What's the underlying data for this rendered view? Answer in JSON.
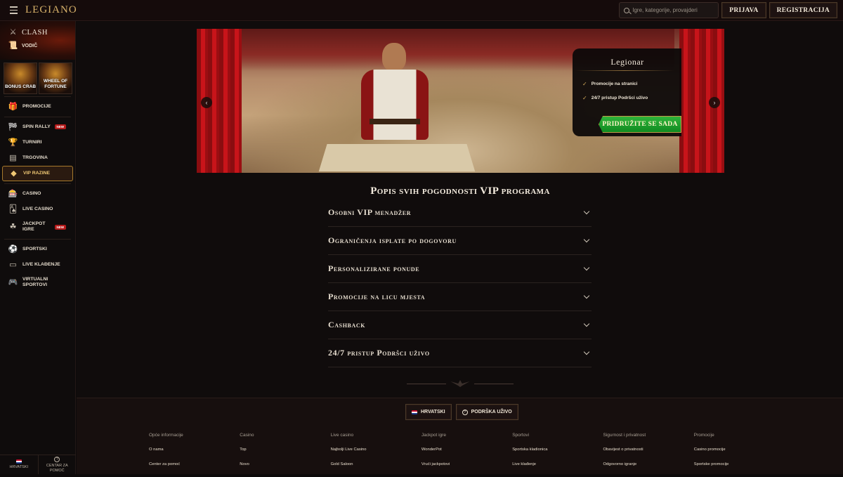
{
  "header": {
    "logo": "LEGIANO",
    "search_placeholder": "Igre, kategorije, provajderi",
    "login_label": "PRIJAVA",
    "register_label": "REGISTRACIJA"
  },
  "sidebar": {
    "clash_label": "CLASH",
    "vodic_label": "VODIČ",
    "tiles": [
      "BONUS CRAB",
      "WHEEL OF FORTUNE"
    ],
    "items": [
      {
        "label": "PROMOCIJE",
        "icon": "gift-icon"
      },
      {
        "label": "SPIN RALLY",
        "icon": "flag-icon",
        "badge": "NEW"
      },
      {
        "label": "TURNIRI",
        "icon": "trophy-icon"
      },
      {
        "label": "TRGOVINA",
        "icon": "shop-icon"
      },
      {
        "label": "VIP RAZINE",
        "icon": "diamond-icon",
        "active": true
      },
      {
        "label": "CASINO",
        "icon": "slot-machine-icon"
      },
      {
        "label": "LIVE CASINO",
        "icon": "cards-icon"
      },
      {
        "label": "JACKPOT IGRE",
        "icon": "clover-icon",
        "badge": "NEW"
      },
      {
        "label": "SPORTSKI",
        "icon": "ball-icon"
      },
      {
        "label": "LIVE KLAĐENJE",
        "icon": "live-icon"
      },
      {
        "label": "VIRTUALNI SPORTOVI",
        "icon": "gamepad-icon"
      }
    ],
    "bottom": {
      "language": "HRVATSKI",
      "help": "CENTAR ZA POMOĆ"
    }
  },
  "banner": {
    "card_title": "Legionar",
    "features": [
      "Promocije na stranici",
      "24/7 pristup Podršci uživo"
    ],
    "cta_label": "PRIDRUŽITE SE SADA"
  },
  "vip": {
    "title": "Popis svih pogodnosti VIP programa",
    "items": [
      "Osobni VIP menadžer",
      "Ograničenja isplate po dogovoru",
      "Personalizirane ponude",
      "Promocije na licu mjesta",
      "Cashback",
      "24/7 pristup Podršci uživo"
    ]
  },
  "footer": {
    "language_btn": "HRVATSKI",
    "support_btn": "PODRŠKA UŽIVO",
    "columns": [
      {
        "head": "Opće informacije",
        "links": [
          "O nama",
          "Center za pomoć"
        ]
      },
      {
        "head": "Casino",
        "links": [
          "Top",
          "Novo"
        ]
      },
      {
        "head": "Live casino",
        "links": [
          "Najbolji Live Casino",
          "Gold Saloon"
        ]
      },
      {
        "head": "Jackpot igre",
        "links": [
          "WonderPot",
          "Vrući jackpotovi"
        ]
      },
      {
        "head": "Sportovi",
        "links": [
          "Sportska kladionica",
          "Live klađenje"
        ]
      },
      {
        "head": "Sigurnost i privatnost",
        "links": [
          "Obavijest o privatnosti",
          "Odgovorno igranje"
        ]
      },
      {
        "head": "Promocije",
        "links": [
          "Casino promocije",
          "Sportske promocije"
        ]
      }
    ]
  },
  "colors": {
    "accent_gold": "#d2aa5a",
    "cta_green": "#1f9e2c",
    "new_badge": "#b51a1a"
  }
}
